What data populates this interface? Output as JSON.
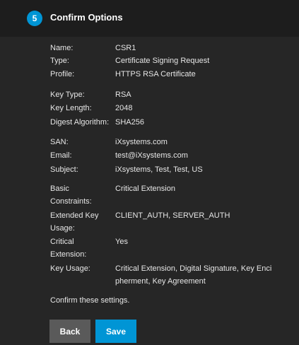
{
  "step": {
    "number": "5",
    "title": "Confirm Options"
  },
  "details": [
    {
      "label": "Name:",
      "value": "CSR1"
    },
    {
      "label": "Type:",
      "value": "Certificate Signing Request"
    },
    {
      "label": "Profile:",
      "value": "HTTPS RSA Certificate"
    },
    {
      "label": "Key Type:",
      "value": "RSA"
    },
    {
      "label": "Key Length:",
      "value": "2048"
    },
    {
      "label": "Digest Algorithm:",
      "value": "SHA256"
    },
    {
      "label": "SAN:",
      "value": "iXsystems.com"
    },
    {
      "label": "Email:",
      "value": "test@iXsystems.com"
    },
    {
      "label": "Subject:",
      "value": "iXsystems, Test, Test, US"
    },
    {
      "label": "Basic Constraints:",
      "value": "Critical Extension"
    },
    {
      "label": "Extended Key Usage:",
      "value": "CLIENT_AUTH, SERVER_AUTH"
    },
    {
      "label": "Critical Extension:",
      "value": "Yes"
    },
    {
      "label": "Key Usage:",
      "value": "Critical Extension, Digital Signature, Key Encipherment, Key Agreement"
    }
  ],
  "confirm_text": "Confirm these settings.",
  "buttons": {
    "back": "Back",
    "save": "Save"
  }
}
